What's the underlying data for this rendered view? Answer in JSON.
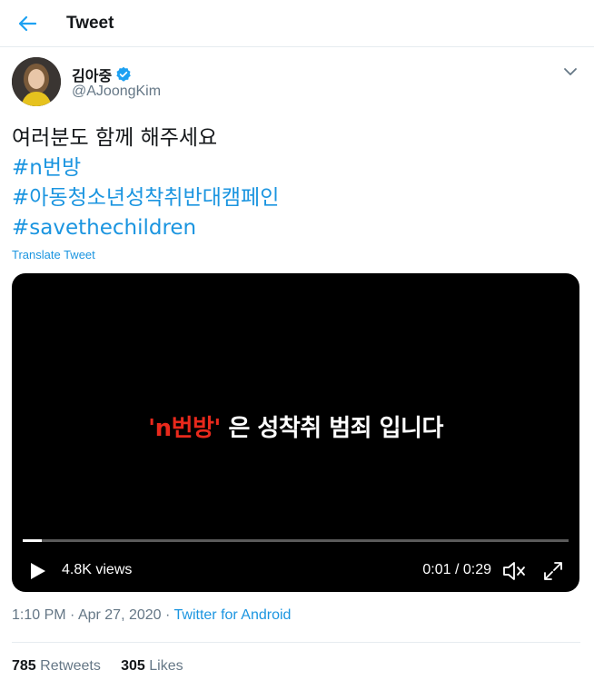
{
  "header": {
    "title": "Tweet",
    "back_icon": "arrow-left-icon",
    "accent": "#1da1f2"
  },
  "author": {
    "name": "김아중",
    "handle": "@AJoongKim",
    "verified": true,
    "verified_color": "#1da1f2"
  },
  "tweet": {
    "text_line1": "여러분도 함께 해주세요",
    "hashtags": [
      "#n번방",
      "#아동청소년성착취반대캠페인",
      "#savethechildren"
    ],
    "translate_label": "Translate Tweet"
  },
  "video": {
    "caption_red": "'n번방'",
    "caption_rest": " 은 성착취 범죄 입니다",
    "views": "4.8K views",
    "time": "0:01 / 0:29",
    "progress": 0.035
  },
  "meta": {
    "time": "1:10 PM",
    "date": "Apr 27, 2020",
    "separator": "·",
    "source": "Twitter for Android"
  },
  "stats": {
    "retweets_count": "785",
    "retweets_label": "Retweets",
    "likes_count": "305",
    "likes_label": "Likes"
  }
}
